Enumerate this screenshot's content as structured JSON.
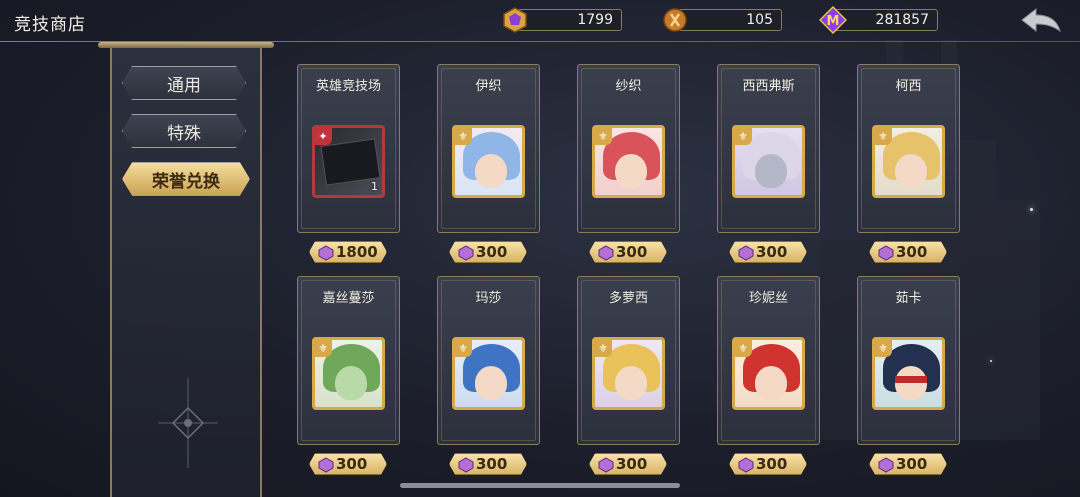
{
  "header": {
    "title": "竞技商店"
  },
  "resources": [
    {
      "icon": "honor-gem-icon",
      "value": "1799"
    },
    {
      "icon": "arena-medal-icon",
      "value": "105"
    },
    {
      "icon": "m-coin-icon",
      "value": "281857"
    }
  ],
  "nav": {
    "items": [
      {
        "label": "通用"
      },
      {
        "label": "特殊"
      },
      {
        "label": "荣誉兑换"
      }
    ],
    "active_index": 2
  },
  "items": [
    {
      "name": "英雄竞技场",
      "price": "1800",
      "count": "1"
    },
    {
      "name": "伊织",
      "price": "300"
    },
    {
      "name": "纱织",
      "price": "300"
    },
    {
      "name": "西西弗斯",
      "price": "300"
    },
    {
      "name": "柯西",
      "price": "300"
    },
    {
      "name": "嘉丝蔓莎",
      "price": "300"
    },
    {
      "name": "玛莎",
      "price": "300"
    },
    {
      "name": "多萝西",
      "price": "300"
    },
    {
      "name": "珍妮丝",
      "price": "300"
    },
    {
      "name": "茹卡",
      "price": "300"
    }
  ],
  "colors": {
    "accent_gold": "#d7a94a",
    "frame": "#8a7c5a",
    "price_bg": "#f6e2a8"
  }
}
